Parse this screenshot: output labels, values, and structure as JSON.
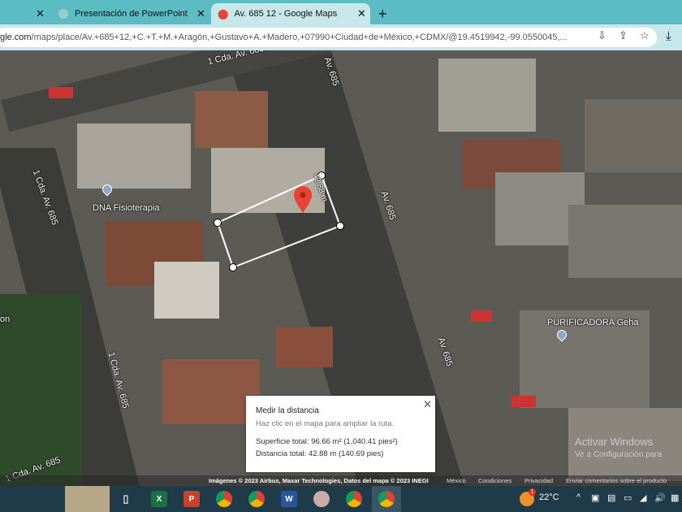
{
  "browser": {
    "tabs": [
      {
        "label": "Presentación de PowerPoint",
        "active": false
      },
      {
        "label": "Av. 685 12 - Google Maps",
        "active": true
      }
    ],
    "new_tab": "+",
    "url_host": "gle.com",
    "url_rest": "/maps/place/Av.+685+12,+C.+T.+M.+Aragón,+Gustavo+A.+Madero,+07990+Ciudad+de+México,+CDMX/@19.4519942,-99.0550045,..."
  },
  "map": {
    "street_labels": [
      "1 Cda. Av. 685",
      "Av. 685",
      "1 Cda. Av. 685",
      "Av. 685",
      "Av. 685",
      "1 Cda. Av. 685",
      "1 Cda. Av. 685"
    ],
    "places": [
      "DNA Fisioterapia",
      "PURIFICADORA Geha"
    ],
    "measure_label": "42.88 m",
    "left_partial": "on"
  },
  "measure_panel": {
    "title": "Medir la distancia",
    "subtitle": "Haz clic en el mapa para ampliar la ruta.",
    "area": "Superficie total: 96.66 m² (1,040.41 pies²)",
    "distance": "Distancia total: 42.88 m (140.69 pies)",
    "close": "✕"
  },
  "attribution": {
    "imagery": "Imágenes © 2023 Airbus, Maxar Technologies, Datos del mapa © 2023 INEGI",
    "region": "México",
    "terms": "Condiciones",
    "privacy": "Privacidad",
    "feedback": "Enviar comentarios sobre el producto"
  },
  "watermark": {
    "line1": "Activar Windows",
    "line2": "Ve a Configuración para"
  },
  "taskbar": {
    "weather": "22°C",
    "notif": "1"
  },
  "colors": {
    "accent": "#5bbcc4",
    "pin": "#ea4335"
  }
}
